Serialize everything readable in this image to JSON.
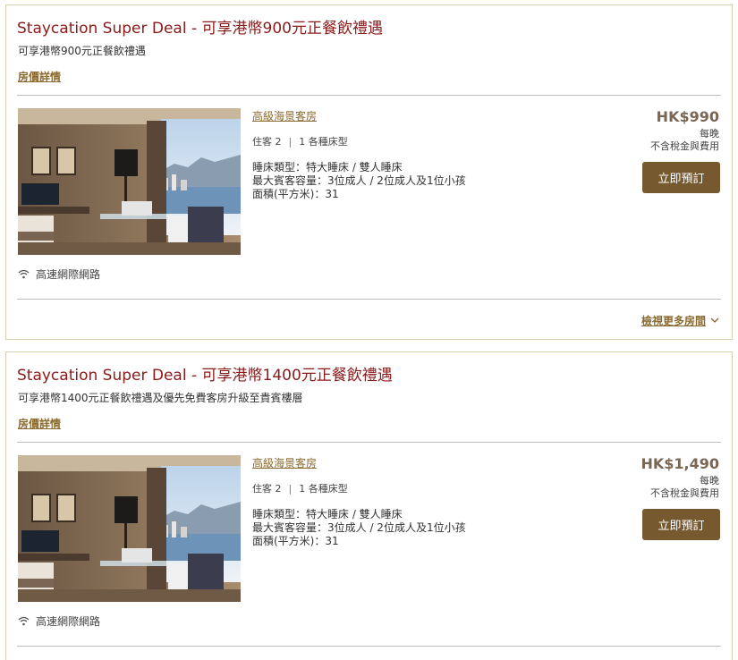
{
  "offers": [
    {
      "title": "Staycation Super Deal - 可享港幣900元正餐飲禮遇",
      "subtitle": "可享港幣900元正餐飲禮遇",
      "rate_details_label": "房價詳情",
      "room": {
        "name": "高級海景客房",
        "guests": "住客 2",
        "beds": "1 各種床型",
        "bed_type": "睡床類型：特大睡床 / 雙人睡床",
        "max_occupancy": "最大賓客容量：3位成人 / 2位成人及1位小孩",
        "area": "面積(平方米)：31",
        "price": "HK$990",
        "per_night": "每晚",
        "tax_note": "不含稅金與費用",
        "book_label": "立即預訂",
        "amenity": "高速網際網路"
      },
      "more_rooms_label": "檢視更多房間"
    },
    {
      "title": "Staycation Super Deal - 可享港幣1400元正餐飲禮遇",
      "subtitle": "可享港幣1400元正餐飲禮遇及優先免費客房升級至貴賓樓層",
      "rate_details_label": "房價詳情",
      "room": {
        "name": "高級海景客房",
        "guests": "住客 2",
        "beds": "1 各種床型",
        "bed_type": "睡床類型：特大睡床 / 雙人睡床",
        "max_occupancy": "最大賓客容量：3位成人 / 2位成人及1位小孩",
        "area": "面積(平方米)：31",
        "price": "HK$1,490",
        "per_night": "每晚",
        "tax_note": "不含稅金與費用",
        "book_label": "立即預訂",
        "amenity": "高速網際網路"
      }
    }
  ],
  "colors": {
    "title": "#8b1a1a",
    "link": "#8b6a2f",
    "button": "#76592f",
    "price": "#7a6652",
    "card_border": "#d8cfae"
  },
  "icons": [
    "wifi-icon",
    "chevron-down-icon"
  ]
}
